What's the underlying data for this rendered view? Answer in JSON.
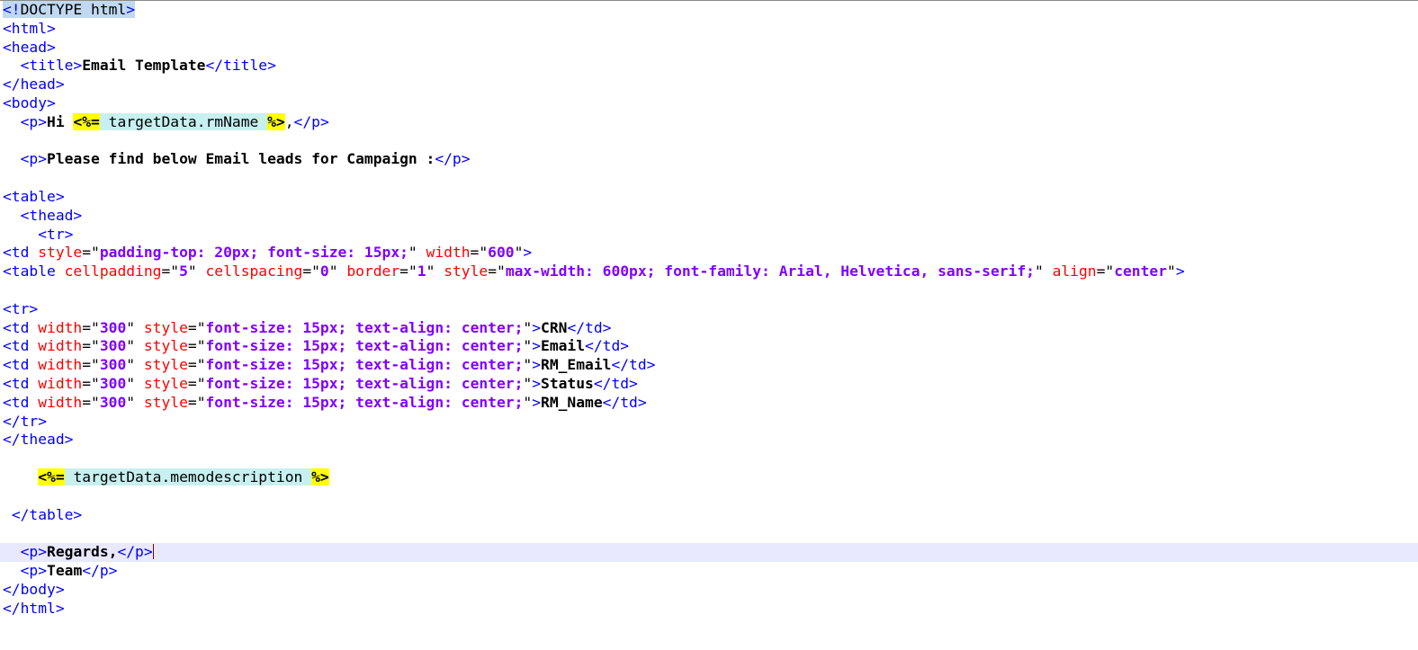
{
  "editor": {
    "lines": [
      [
        {
          "c": "t",
          "s": "<!",
          "hl": true
        },
        {
          "c": "plain",
          "s": "DOCTYPE html",
          "hl": true
        },
        {
          "c": "t",
          "s": ">",
          "hl": true
        }
      ],
      [
        {
          "c": "t",
          "s": "<html>"
        }
      ],
      [
        {
          "c": "t",
          "s": "<head>"
        }
      ],
      [
        {
          "c": "plain",
          "s": "  "
        },
        {
          "c": "t",
          "s": "<title>"
        },
        {
          "c": "tx",
          "s": "Email Template"
        },
        {
          "c": "t",
          "s": "</title>"
        }
      ],
      [
        {
          "c": "t",
          "s": "</head>"
        }
      ],
      [
        {
          "c": "t",
          "s": "<body>"
        }
      ],
      [
        {
          "c": "plain",
          "s": "  "
        },
        {
          "c": "t",
          "s": "<p>"
        },
        {
          "c": "tx",
          "s": "Hi "
        },
        {
          "c": "ejs-delim",
          "s": "<%="
        },
        {
          "c": "ejs-body",
          "s": " targetData.rmName "
        },
        {
          "c": "ejs-delim",
          "s": "%>"
        },
        {
          "c": "plain",
          "s": ","
        },
        {
          "c": "t",
          "s": "</p>"
        }
      ],
      [],
      [
        {
          "c": "plain",
          "s": "  "
        },
        {
          "c": "t",
          "s": "<p>"
        },
        {
          "c": "tx",
          "s": "Please find below Email leads for Campaign :"
        },
        {
          "c": "t",
          "s": "</p>"
        }
      ],
      [],
      [
        {
          "c": "t",
          "s": "<table>"
        }
      ],
      [
        {
          "c": "plain",
          "s": "  "
        },
        {
          "c": "t",
          "s": "<thead>"
        }
      ],
      [
        {
          "c": "plain",
          "s": "    "
        },
        {
          "c": "t",
          "s": "<tr>"
        }
      ],
      [
        {
          "c": "t",
          "s": "<td "
        },
        {
          "c": "a",
          "s": "style"
        },
        {
          "c": "q",
          "s": "=\""
        },
        {
          "c": "v",
          "s": "padding-top: 20px; font-size: 15px;"
        },
        {
          "c": "q",
          "s": "\" "
        },
        {
          "c": "a",
          "s": "width"
        },
        {
          "c": "q",
          "s": "=\""
        },
        {
          "c": "v",
          "s": "600"
        },
        {
          "c": "q",
          "s": "\""
        },
        {
          "c": "t",
          "s": ">"
        }
      ],
      [
        {
          "c": "t",
          "s": "<table "
        },
        {
          "c": "a",
          "s": "cellpadding"
        },
        {
          "c": "q",
          "s": "=\""
        },
        {
          "c": "v",
          "s": "5"
        },
        {
          "c": "q",
          "s": "\" "
        },
        {
          "c": "a",
          "s": "cellspacing"
        },
        {
          "c": "q",
          "s": "=\""
        },
        {
          "c": "v",
          "s": "0"
        },
        {
          "c": "q",
          "s": "\" "
        },
        {
          "c": "a",
          "s": "border"
        },
        {
          "c": "q",
          "s": "=\""
        },
        {
          "c": "v",
          "s": "1"
        },
        {
          "c": "q",
          "s": "\" "
        },
        {
          "c": "a",
          "s": "style"
        },
        {
          "c": "q",
          "s": "=\""
        },
        {
          "c": "v",
          "s": "max-width: 600px; font-family: Arial, Helvetica, sans-serif;"
        },
        {
          "c": "q",
          "s": "\" "
        },
        {
          "c": "a",
          "s": "align"
        },
        {
          "c": "q",
          "s": "=\""
        },
        {
          "c": "v",
          "s": "center"
        },
        {
          "c": "q",
          "s": "\""
        },
        {
          "c": "t",
          "s": ">"
        }
      ],
      [],
      [
        {
          "c": "t",
          "s": "<tr>"
        }
      ],
      [
        {
          "c": "t",
          "s": "<td "
        },
        {
          "c": "a",
          "s": "width"
        },
        {
          "c": "q",
          "s": "=\""
        },
        {
          "c": "v",
          "s": "300"
        },
        {
          "c": "q",
          "s": "\" "
        },
        {
          "c": "a",
          "s": "style"
        },
        {
          "c": "q",
          "s": "=\""
        },
        {
          "c": "v",
          "s": "font-size: 15px; text-align: center;"
        },
        {
          "c": "q",
          "s": "\""
        },
        {
          "c": "t",
          "s": ">"
        },
        {
          "c": "tx",
          "s": "CRN"
        },
        {
          "c": "t",
          "s": "</td>"
        }
      ],
      [
        {
          "c": "t",
          "s": "<td "
        },
        {
          "c": "a",
          "s": "width"
        },
        {
          "c": "q",
          "s": "=\""
        },
        {
          "c": "v",
          "s": "300"
        },
        {
          "c": "q",
          "s": "\" "
        },
        {
          "c": "a",
          "s": "style"
        },
        {
          "c": "q",
          "s": "=\""
        },
        {
          "c": "v",
          "s": "font-size: 15px; text-align: center;"
        },
        {
          "c": "q",
          "s": "\""
        },
        {
          "c": "t",
          "s": ">"
        },
        {
          "c": "tx",
          "s": "Email"
        },
        {
          "c": "t",
          "s": "</td>"
        }
      ],
      [
        {
          "c": "t",
          "s": "<td "
        },
        {
          "c": "a",
          "s": "width"
        },
        {
          "c": "q",
          "s": "=\""
        },
        {
          "c": "v",
          "s": "300"
        },
        {
          "c": "q",
          "s": "\" "
        },
        {
          "c": "a",
          "s": "style"
        },
        {
          "c": "q",
          "s": "=\""
        },
        {
          "c": "v",
          "s": "font-size: 15px; text-align: center;"
        },
        {
          "c": "q",
          "s": "\""
        },
        {
          "c": "t",
          "s": ">"
        },
        {
          "c": "tx",
          "s": "RM_Email"
        },
        {
          "c": "t",
          "s": "</td>"
        }
      ],
      [
        {
          "c": "t",
          "s": "<td "
        },
        {
          "c": "a",
          "s": "width"
        },
        {
          "c": "q",
          "s": "=\""
        },
        {
          "c": "v",
          "s": "300"
        },
        {
          "c": "q",
          "s": "\" "
        },
        {
          "c": "a",
          "s": "style"
        },
        {
          "c": "q",
          "s": "=\""
        },
        {
          "c": "v",
          "s": "font-size: 15px; text-align: center;"
        },
        {
          "c": "q",
          "s": "\""
        },
        {
          "c": "t",
          "s": ">"
        },
        {
          "c": "tx",
          "s": "Status"
        },
        {
          "c": "t",
          "s": "</td>"
        }
      ],
      [
        {
          "c": "t",
          "s": "<td "
        },
        {
          "c": "a",
          "s": "width"
        },
        {
          "c": "q",
          "s": "=\""
        },
        {
          "c": "v",
          "s": "300"
        },
        {
          "c": "q",
          "s": "\" "
        },
        {
          "c": "a",
          "s": "style"
        },
        {
          "c": "q",
          "s": "=\""
        },
        {
          "c": "v",
          "s": "font-size: 15px; text-align: center;"
        },
        {
          "c": "q",
          "s": "\""
        },
        {
          "c": "t",
          "s": ">"
        },
        {
          "c": "tx",
          "s": "RM_Name"
        },
        {
          "c": "t",
          "s": "</td>"
        }
      ],
      [
        {
          "c": "t",
          "s": "</tr>"
        }
      ],
      [
        {
          "c": "t",
          "s": "</thead>"
        }
      ],
      [],
      [
        {
          "c": "plain",
          "s": "    "
        },
        {
          "c": "ejs-delim",
          "s": "<%="
        },
        {
          "c": "ejs-body",
          "s": " targetData.memodescription "
        },
        {
          "c": "ejs-delim",
          "s": "%>"
        }
      ],
      [],
      [
        {
          "c": "plain",
          "s": " "
        },
        {
          "c": "t",
          "s": "</table>"
        }
      ],
      [],
      [
        {
          "c": "plain",
          "s": "  "
        },
        {
          "c": "t",
          "s": "<p>"
        },
        {
          "c": "tx",
          "s": "Regards,"
        },
        {
          "c": "t",
          "s": "</p>"
        },
        {
          "caret": true
        }
      ],
      [
        {
          "c": "plain",
          "s": "  "
        },
        {
          "c": "t",
          "s": "<p>"
        },
        {
          "c": "tx",
          "s": "Team"
        },
        {
          "c": "t",
          "s": "</p>"
        }
      ],
      [
        {
          "c": "t",
          "s": "</body>"
        }
      ],
      [
        {
          "c": "t",
          "s": "</html>"
        }
      ]
    ],
    "current_line": 29,
    "colors": {
      "tag": "#0000ff",
      "attribute": "#ff0000",
      "value": "#8000ff",
      "current_line_bg": "#e8e8ff",
      "ejs_delimiter_bg": "#ffff00",
      "ejs_body_bg": "#c8f0f0"
    }
  }
}
